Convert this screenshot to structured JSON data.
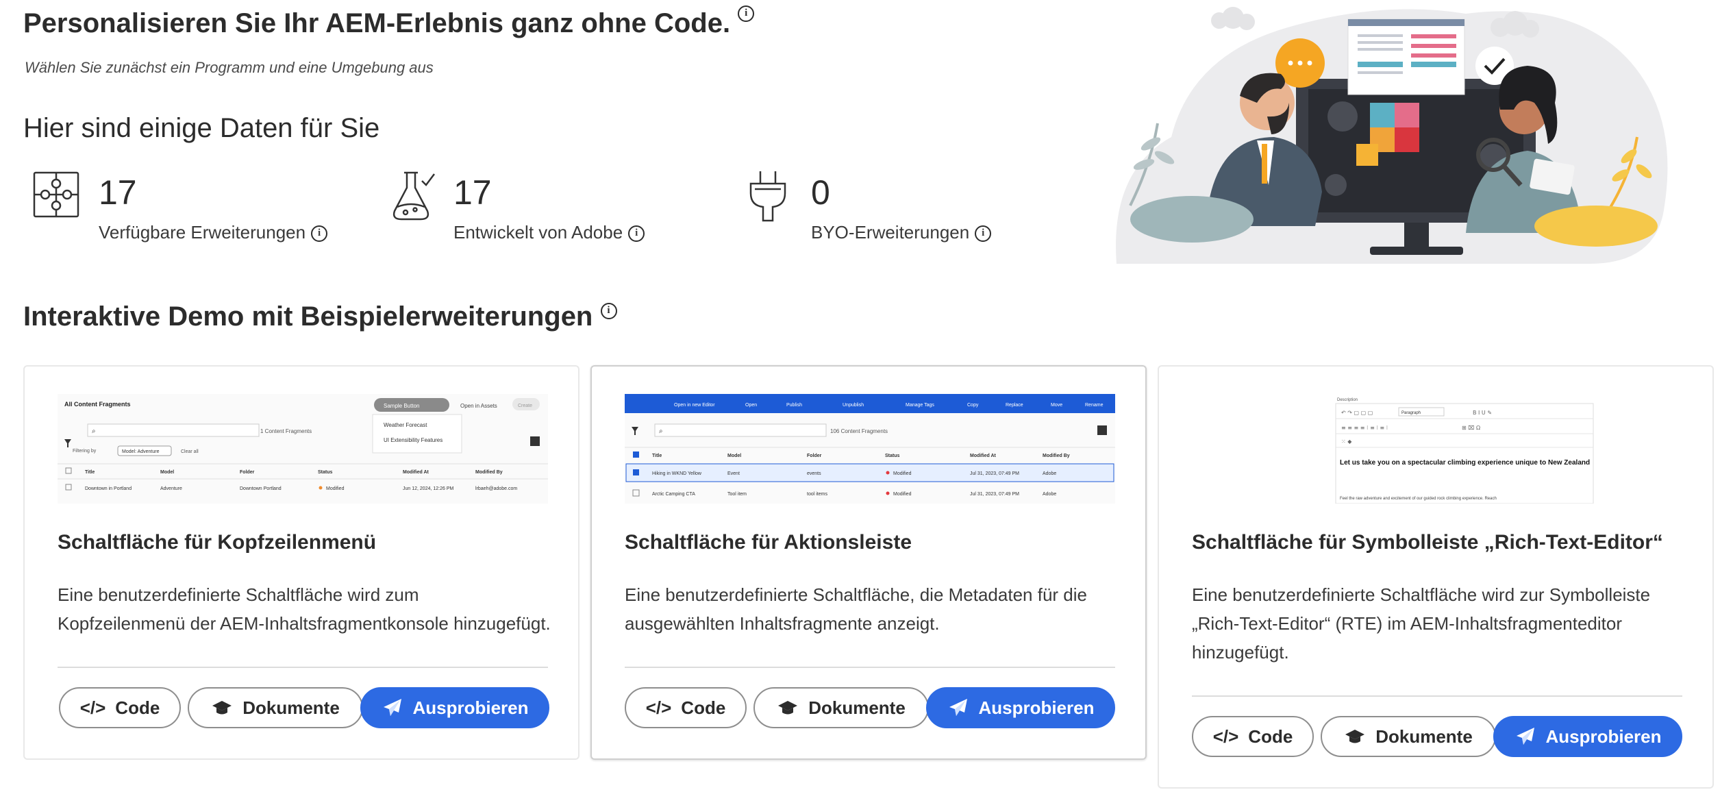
{
  "header": {
    "title": "Personalisieren Sie Ihr AEM-Erlebnis ganz ohne Code.",
    "subtitle": "Wählen Sie zunächst ein Programm und eine Umgebung aus",
    "data_heading": "Hier sind einige Daten für Sie"
  },
  "stats": [
    {
      "value": "17",
      "label": "Verfügbare Erweiterungen",
      "icon": "puzzle-icon"
    },
    {
      "value": "17",
      "label": "Entwickelt von Adobe",
      "icon": "flask-icon"
    },
    {
      "value": "0",
      "label": "BYO-Erweiterungen",
      "icon": "plug-icon"
    }
  ],
  "info_glyph": "i",
  "section_title": "Interaktive Demo mit Beispielerweiterungen",
  "cards": [
    {
      "title": "Schaltfläche für Kopfzeilenmenü",
      "description": "Eine benutzerdefinierte Schaltfläche wird zum Kopfzeilenmenü der AEM-Inhaltsfragmentkonsole hinzugefügt.",
      "thumb": {
        "heading": "All Content Fragments",
        "sample_button": "Sample Button",
        "open_in_assets": "Open in Assets",
        "create": "Create",
        "menu_items": [
          "Weather Forecast",
          "UI Extensibility Features"
        ],
        "count_label": "1 Content Fragments",
        "filtering_by": "Filtering by",
        "filter_tag": "Model: Adventure",
        "clear_all": "Clear all",
        "columns": [
          "Title",
          "Model",
          "Folder",
          "Status",
          "Modified At",
          "Modified By"
        ],
        "row": [
          "Downtown in Portland",
          "Adventure",
          "Downtown Portland",
          "Modified",
          "Jun 12, 2024, 12:26 PM",
          "lrbaeh@adobe.com"
        ]
      }
    },
    {
      "title": "Schaltfläche für Aktionsleiste",
      "description": "Eine benutzerdefinierte Schaltfläche, die Metadaten für die ausgewählten Inhaltsfragmente anzeigt.",
      "thumb": {
        "actions": [
          "Open in new Editor",
          "Open",
          "Publish",
          "Unpublish",
          "Manage Tags",
          "Copy",
          "Replace",
          "Move",
          "Rename"
        ],
        "count_label": "106 Content Fragments",
        "columns": [
          "Title",
          "Model",
          "Folder",
          "Status",
          "Modified At",
          "Modified By"
        ],
        "rows": [
          [
            "Hiking in WKND Yellow",
            "Event",
            "events",
            "Modified",
            "Jul 31, 2023, 07:49 PM",
            "Adobe"
          ],
          [
            "Arctic Camping CTA",
            "Tool item",
            "tool items",
            "Modified",
            "Jul 31, 2023, 07:49 PM",
            "Adobe"
          ]
        ]
      }
    },
    {
      "title": "Schaltfläche für Symbolleiste „Rich-Text-Editor“",
      "description": "Eine benutzerdefinierte Schaltfläche wird zur Symbolleiste „Rich-Text-Editor“ (RTE) im AEM-Inhaltsfragmenteditor hinzugefügt.",
      "thumb": {
        "label": "Description",
        "paragraph": "Paragraph",
        "headline": "Let us take you on a spectacular climbing experience unique to New Zealand",
        "body": "Feel the raw adventure and excitement of our guided rock climbing experience. Reach"
      }
    }
  ],
  "buttons": {
    "code": "Code",
    "docs": "Dokumente",
    "try": "Ausprobieren"
  },
  "colors": {
    "primary": "#2d6ae3",
    "text": "#2c2c2c"
  }
}
